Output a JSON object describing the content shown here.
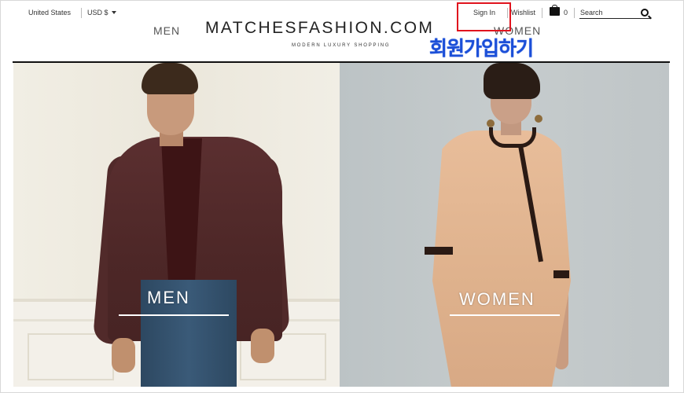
{
  "utility_bar": {
    "country": "United States",
    "currency": "USD $",
    "sign_in": "Sign In",
    "wishlist": "Wishlist",
    "bag_count": "0",
    "search_placeholder": "Search"
  },
  "header": {
    "nav_men": "MEN",
    "nav_women": "WOMEN",
    "logo": "MATCHESFASHION.COM",
    "tagline": "MODERN LUXURY SHOPPING"
  },
  "annotation": {
    "text": "회원가입하기",
    "color": "#1b4fd8",
    "highlight_color": "#e0141e"
  },
  "hero": {
    "men_label": "MEN",
    "women_label": "WOMEN"
  }
}
